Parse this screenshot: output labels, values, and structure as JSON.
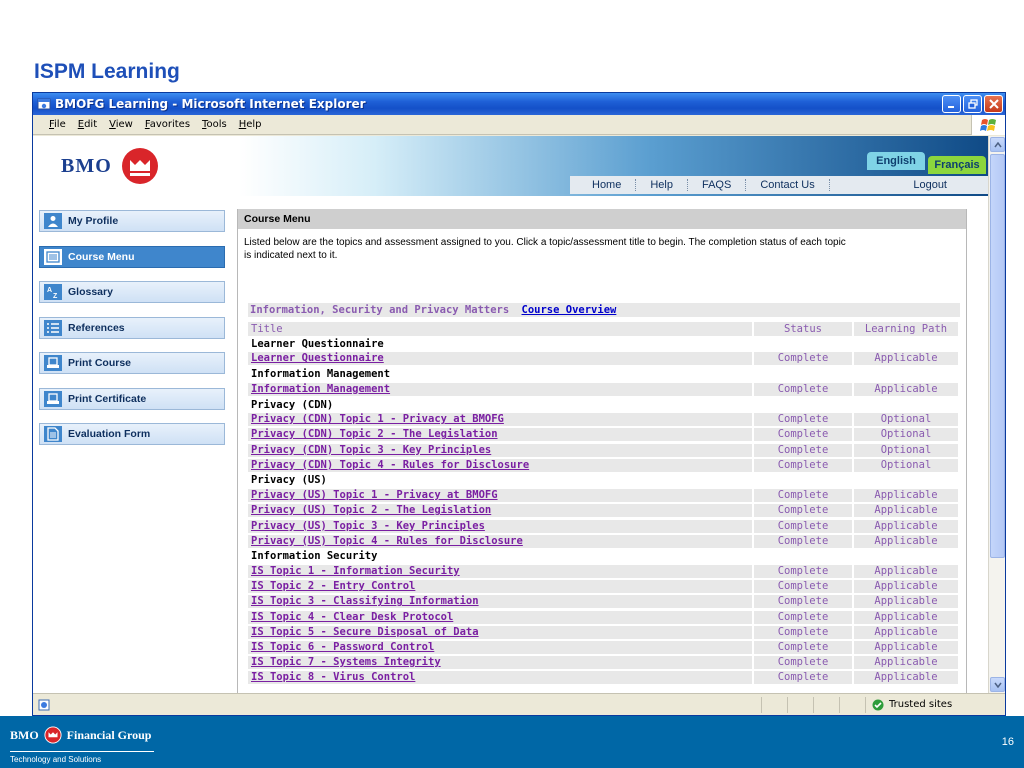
{
  "slide": {
    "title": "ISPM Learning",
    "page_number": "16",
    "footer_brand": "Financial Group",
    "footer_brand_prefix": "BMO",
    "footer_tagline": "Technology and Solutions"
  },
  "window": {
    "title": "BMOFG Learning - Microsoft Internet Explorer",
    "menu": [
      "File",
      "Edit",
      "View",
      "Favorites",
      "Tools",
      "Help"
    ],
    "status_zone": "Trusted sites"
  },
  "header": {
    "logo_text": "BMO",
    "lang_english": "English",
    "lang_french": "Français",
    "nav": [
      "Home",
      "Help",
      "FAQS",
      "Contact Us",
      "Logout"
    ]
  },
  "sidebar": {
    "items": [
      {
        "label": "My Profile",
        "icon": "person-icon",
        "active": false
      },
      {
        "label": "Course Menu",
        "icon": "menu-icon",
        "active": true
      },
      {
        "label": "Glossary",
        "icon": "glossary-icon",
        "active": false
      },
      {
        "label": "References",
        "icon": "list-icon",
        "active": false
      },
      {
        "label": "Print Course",
        "icon": "printer-icon",
        "active": false
      },
      {
        "label": "Print Certificate",
        "icon": "printer-icon",
        "active": false
      },
      {
        "label": "Evaluation Form",
        "icon": "document-icon",
        "active": false
      }
    ]
  },
  "main": {
    "panel_title": "Course Menu",
    "intro": "Listed below are the topics and assessment assigned to you. Click a topic/assessment title to begin. The completion status of each topic is indicated next to it.",
    "course_title": "Information, Security and Privacy Matters",
    "course_overview_link": "Course Overview",
    "columns": {
      "title": "Title",
      "status": "Status",
      "path": "Learning Path"
    },
    "rows": [
      {
        "type": "group",
        "title": "Learner Questionnaire"
      },
      {
        "type": "item",
        "title": "Learner Questionnaire",
        "status": "Complete",
        "path": "Applicable"
      },
      {
        "type": "group",
        "title": "Information Management"
      },
      {
        "type": "item",
        "title": "Information Management",
        "status": "Complete",
        "path": "Applicable"
      },
      {
        "type": "group",
        "title": "Privacy (CDN)"
      },
      {
        "type": "item",
        "title": "Privacy (CDN) Topic 1 - Privacy at BMOFG",
        "status": "Complete",
        "path": "Optional"
      },
      {
        "type": "item",
        "title": "Privacy (CDN) Topic 2 - The Legislation",
        "status": "Complete",
        "path": "Optional"
      },
      {
        "type": "item",
        "title": "Privacy (CDN) Topic 3 - Key Principles",
        "status": "Complete",
        "path": "Optional"
      },
      {
        "type": "item",
        "title": "Privacy (CDN) Topic 4 - Rules for Disclosure",
        "status": "Complete",
        "path": "Optional"
      },
      {
        "type": "group",
        "title": "Privacy (US)"
      },
      {
        "type": "item",
        "title": "Privacy (US) Topic 1 - Privacy at BMOFG",
        "status": "Complete",
        "path": "Applicable"
      },
      {
        "type": "item",
        "title": "Privacy (US) Topic 2 - The Legislation",
        "status": "Complete",
        "path": "Applicable"
      },
      {
        "type": "item",
        "title": "Privacy (US) Topic 3 - Key Principles",
        "status": "Complete",
        "path": "Applicable"
      },
      {
        "type": "item",
        "title": "Privacy (US) Topic 4 - Rules for Disclosure",
        "status": "Complete",
        "path": "Applicable"
      },
      {
        "type": "group",
        "title": "Information Security"
      },
      {
        "type": "item",
        "title": "IS Topic 1 - Information Security",
        "status": "Complete",
        "path": "Applicable"
      },
      {
        "type": "item",
        "title": "IS Topic 2 - Entry Control",
        "status": "Complete",
        "path": "Applicable"
      },
      {
        "type": "item",
        "title": "IS Topic 3 - Classifying Information",
        "status": "Complete",
        "path": "Applicable"
      },
      {
        "type": "item",
        "title": "IS Topic 4 - Clear Desk Protocol",
        "status": "Complete",
        "path": "Applicable"
      },
      {
        "type": "item",
        "title": "IS Topic 5 - Secure Disposal of Data",
        "status": "Complete",
        "path": "Applicable"
      },
      {
        "type": "item",
        "title": "IS Topic 6 - Password Control",
        "status": "Complete",
        "path": "Applicable"
      },
      {
        "type": "item",
        "title": "IS Topic 7 - Systems Integrity",
        "status": "Complete",
        "path": "Applicable"
      },
      {
        "type": "item",
        "title": "IS Topic 8 - Virus Control",
        "status": "Complete",
        "path": "Applicable"
      }
    ]
  },
  "colors": {
    "slide_title": "#1e4fb8",
    "footer": "#0067a6",
    "link_purple": "#7a1fa2",
    "status_purple": "#8a5bb0",
    "active_tile": "#3f86cc",
    "bmo_red": "#d9252a"
  }
}
